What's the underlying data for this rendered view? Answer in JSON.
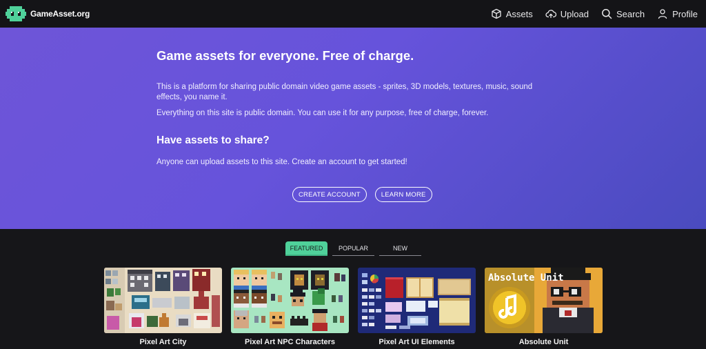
{
  "nav": {
    "brand": "GameAsset.org",
    "links": [
      {
        "label": "Assets",
        "icon": "cube-icon"
      },
      {
        "label": "Upload",
        "icon": "cloud-upload-icon"
      },
      {
        "label": "Search",
        "icon": "search-icon"
      },
      {
        "label": "Profile",
        "icon": "user-icon"
      }
    ]
  },
  "hero": {
    "title": "Game assets for everyone. Free of charge.",
    "paragraph1": "This is a platform for sharing public domain video game assets - sprites, 3D models, textures, music, sound effects, you name it.",
    "paragraph2": "Everything on this site is public domain. You can use it for any purpose, free of charge, forever.",
    "subtitle": "Have assets to share?",
    "paragraph3": "Anyone can upload assets to this site. Create an account to get started!",
    "buttons": {
      "create_account": "CREATE ACCOUNT",
      "learn_more": "LEARN MORE"
    }
  },
  "tabs": [
    {
      "label": "FEATURED",
      "active": true
    },
    {
      "label": "POPULAR",
      "active": false
    },
    {
      "label": "NEW",
      "active": false
    }
  ],
  "cards": [
    {
      "title": "Pixel Art City"
    },
    {
      "title": "Pixel Art NPC Characters"
    },
    {
      "title": "Pixel Art UI Elements"
    },
    {
      "title": "Absolute Unit",
      "thumb_text": "Absolute Unit"
    }
  ],
  "colors": {
    "accent_green": "#4fd19a",
    "hero_purple": "#6653db",
    "navbar": "#141417"
  }
}
